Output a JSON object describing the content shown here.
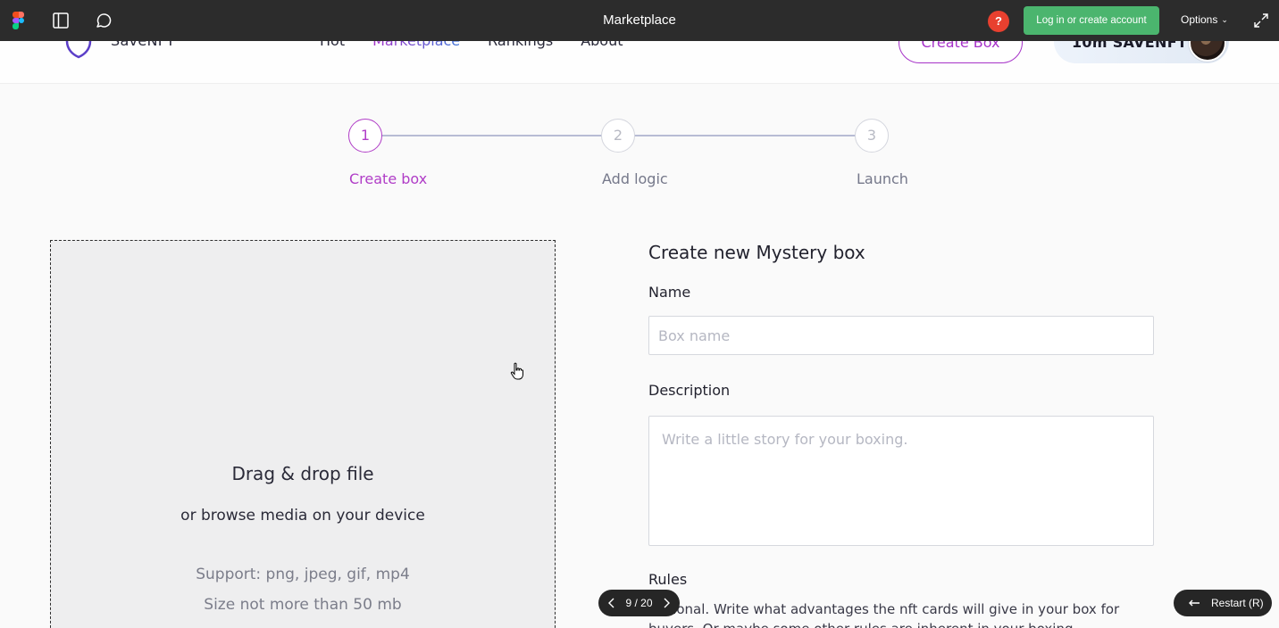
{
  "figma": {
    "title": "Marketplace",
    "help_badge": "?",
    "login_label": "Log in or create account",
    "options_label": "Options",
    "pager": "9 / 20",
    "restart_label": "Restart (R)",
    "icons": [
      "figma-logo",
      "sidebar-toggle-icon",
      "comment-icon",
      "help-icon",
      "chevron-down-icon",
      "expand-icon",
      "chevron-left-icon",
      "chevron-right-icon",
      "restart-arrow-icon"
    ],
    "colors": {
      "bar": "#2c2c2c",
      "login": "#4bb56e",
      "help": "#e8402f"
    }
  },
  "site": {
    "brand": "SaveNFT",
    "nav": [
      "Hot",
      "Marketplace",
      "Rankings",
      "About"
    ],
    "nav_active": "Marketplace",
    "create_box": "Create Box",
    "balance": "10m SAVENFT",
    "colors": {
      "accent": "#a632c8",
      "accent_blue": "#3e73d8"
    }
  },
  "stepper": {
    "steps": [
      {
        "number": "1",
        "label": "Create box",
        "active": true
      },
      {
        "number": "2",
        "label": "Add logic",
        "active": false
      },
      {
        "number": "3",
        "label": "Launch",
        "active": false
      }
    ]
  },
  "dropzone": {
    "title": "Drag & drop file",
    "subtitle": "or browse media on your device",
    "support": "Support: png, jpeg, gif, mp4",
    "size": "Size not more than 50 mb"
  },
  "form": {
    "title": "Create new Mystery box",
    "name_label": "Name",
    "name_placeholder": "Box name",
    "description_label": "Description",
    "description_placeholder": "Write a little story for your boxing.",
    "rules_label": "Rules",
    "rules_help": "Optional. Write what advantages the nft cards will give in your box for buyers. Or maybe some other rules are inherent in your boxing."
  }
}
